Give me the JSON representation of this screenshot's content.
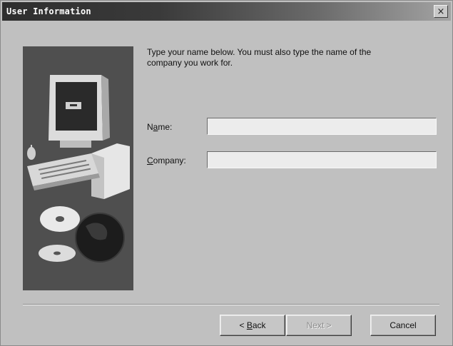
{
  "window": {
    "title": "User Information",
    "close_glyph": "×"
  },
  "illustration": {
    "icon": "computer-setup-graphic",
    "background_color": "#4b4b4b"
  },
  "intro": {
    "line1": "Type your name below. You must also type the name of the",
    "line2": "company you work for."
  },
  "fields": {
    "name": {
      "label_pre": "N",
      "label_acc": "a",
      "label_post": "me:",
      "value": ""
    },
    "company": {
      "label_pre": "",
      "label_acc": "C",
      "label_post": "ompany:",
      "value": ""
    }
  },
  "buttons": {
    "back": {
      "prefix": "< ",
      "acc": "B",
      "rest": "ack"
    },
    "next": {
      "label": "Next >",
      "disabled": true
    },
    "cancel": {
      "label": "Cancel"
    }
  }
}
